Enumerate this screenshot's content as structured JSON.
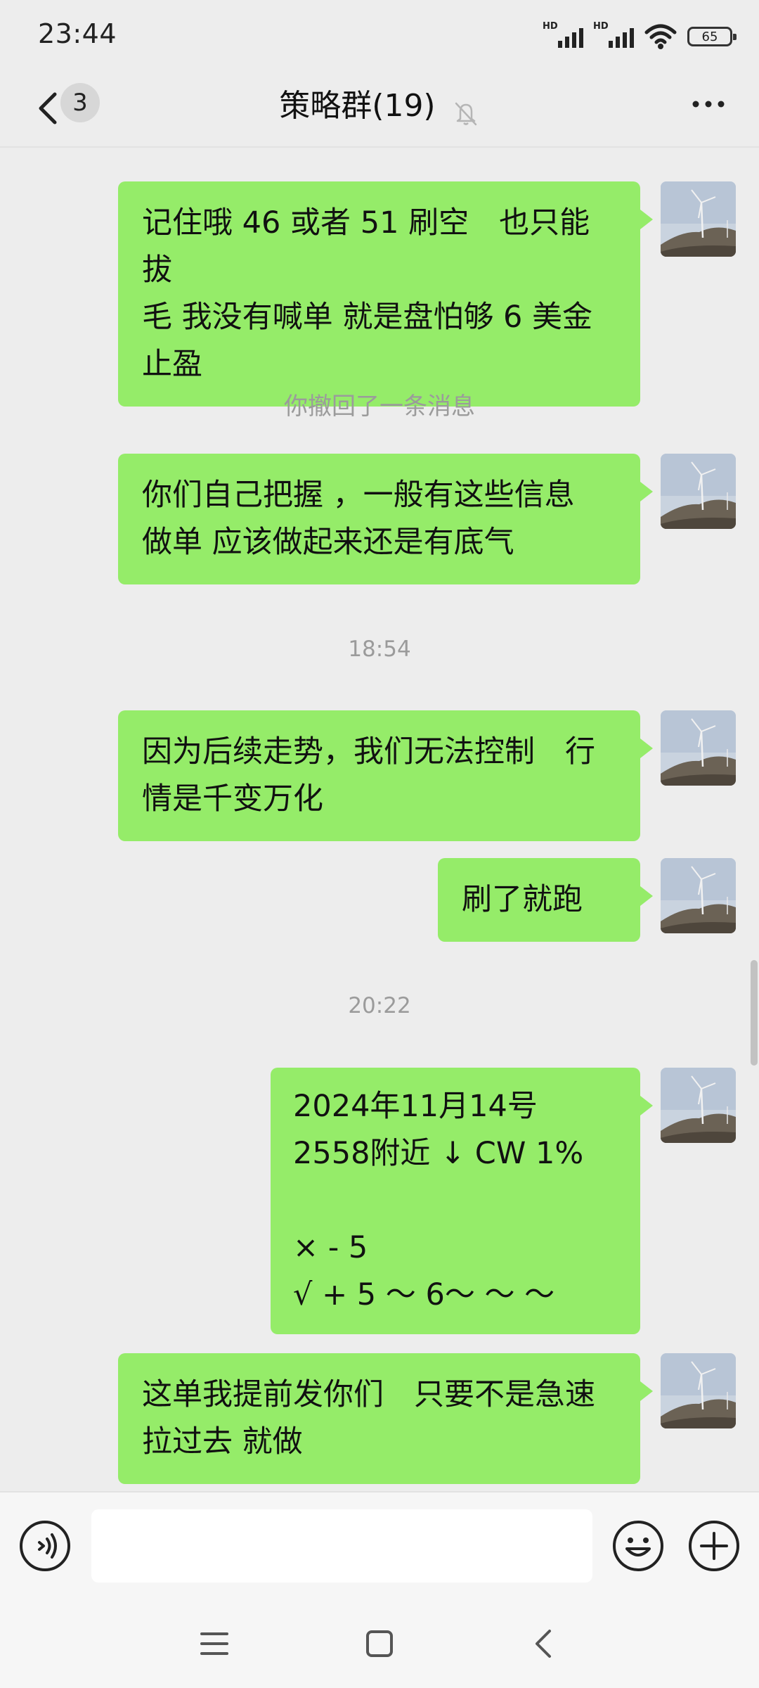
{
  "status_bar": {
    "time": "23:44",
    "signal1_label": "HD",
    "signal2_label": "HD",
    "battery": "65"
  },
  "header": {
    "back_count": "3",
    "title": "策略群(19)",
    "mute_icon": "bell-off-icon",
    "more_icon": "more-dots-icon"
  },
  "messages": [
    {
      "type": "me",
      "lines": [
        "记住哦 46 或者 51 刷空　也只能拔",
        "毛  我没有喊单  就是盘怕够 6 美金",
        "止盈"
      ]
    },
    {
      "type": "system",
      "text": "你撤回了一条消息"
    },
    {
      "type": "me",
      "lines": [
        "你们自己把握 ，一般有这些信息",
        "做单  应该做起来还是有底气"
      ]
    },
    {
      "type": "timestamp",
      "text": "18:54"
    },
    {
      "type": "me",
      "lines": [
        "因为后续走势，我们无法控制　行",
        "情是千变万化"
      ]
    },
    {
      "type": "me",
      "lines": [
        "刷了就跑"
      ]
    },
    {
      "type": "timestamp",
      "text": "20:22"
    },
    {
      "type": "me",
      "lines": [
        "2024年11月14号",
        "2558附近 ↓ CW 1%",
        "",
        "×  - 5",
        "√  +  5 ～ 6～ ～ ～"
      ]
    },
    {
      "type": "me",
      "lines": [
        "这单我提前发你们　只要不是急速",
        "拉过去 就做"
      ]
    }
  ],
  "input_bar": {
    "voice_icon": "voice-icon",
    "text_value": "",
    "emoji_icon": "emoji-icon",
    "plus_icon": "plus-icon"
  },
  "nav_bar": {
    "menu_icon": "menu-icon",
    "home_icon": "home-icon",
    "back_icon": "back-icon"
  },
  "colors": {
    "bubble": "#95ec69",
    "background": "#ededed"
  }
}
